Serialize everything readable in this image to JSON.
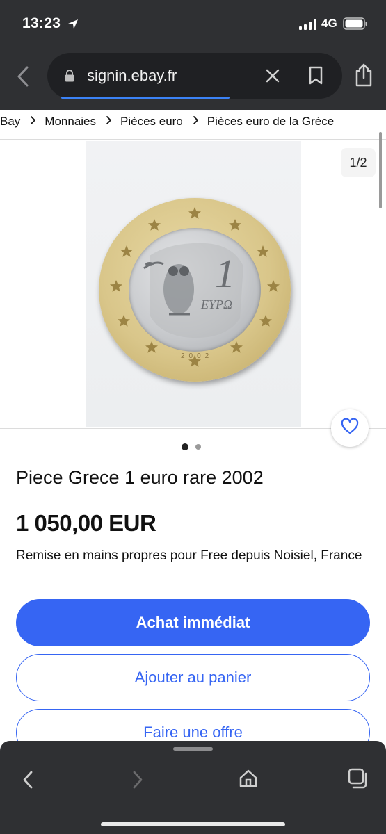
{
  "status_bar": {
    "time": "13:23",
    "network": "4G"
  },
  "browser": {
    "url": "signin.ebay.fr"
  },
  "breadcrumb": [
    "Bay",
    "Monnaies",
    "Pièces euro",
    "Pièces euro de la Grèce"
  ],
  "gallery": {
    "pager": "1/2",
    "coin": {
      "numeral": "1",
      "legend": "ΕΥΡΩ",
      "year": "2002"
    },
    "dots_total": 2,
    "dots_active": 1
  },
  "item": {
    "title": "Piece Grece 1 euro rare 2002",
    "price": "1 050,00 EUR",
    "pickup": "Remise en mains propres pour Free depuis Noisiel, France"
  },
  "actions": {
    "buy_now": "Achat immédiat",
    "add_to_cart": "Ajouter au panier",
    "make_offer": "Faire une offre"
  },
  "colors": {
    "accent": "#3665f3",
    "chrome": "#2f3033"
  },
  "icons": [
    "location-arrow-icon",
    "signal-icon",
    "battery-icon",
    "chevron-left-icon",
    "lock-icon",
    "close-icon",
    "bookmark-icon",
    "share-icon",
    "chevron-right-icon",
    "heart-icon",
    "home-icon",
    "tabs-icon"
  ]
}
